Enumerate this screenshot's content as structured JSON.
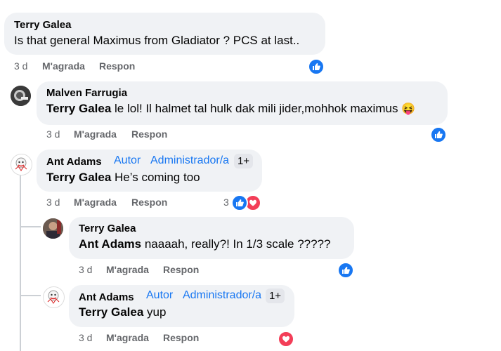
{
  "comments": [
    {
      "author": "Terry Galea",
      "text": "Is that general Maximus from Gladiator ? PCS at last..",
      "time": "3 d",
      "like_label": "M'agrada",
      "reply_label": "Respon",
      "reactions": [
        "like"
      ]
    },
    {
      "author": "Malven Farrugia",
      "mention": "Terry Galea",
      "text": " le lol! Il halmet tal hulk dak mili jider,mohhok maximus",
      "emoji": "😝",
      "time": "3 d",
      "like_label": "M'agrada",
      "reply_label": "Respon",
      "reactions": [
        "like"
      ]
    },
    {
      "author": "Ant Adams",
      "badges": [
        "Autor",
        "Administrador/a"
      ],
      "more_badge": "1+",
      "mention": "Terry Galea",
      "text": " He’s coming too",
      "time": "3 d",
      "like_label": "M'agrada",
      "reply_label": "Respon",
      "reaction_count": "3",
      "reactions": [
        "like",
        "love"
      ]
    },
    {
      "author": "Terry Galea",
      "mention": "Ant Adams",
      "text": " naaaah, really?! In 1/3 scale ?????",
      "time": "3 d",
      "like_label": "M'agrada",
      "reply_label": "Respon",
      "reactions": [
        "like"
      ]
    },
    {
      "author": "Ant Adams",
      "badges": [
        "Autor",
        "Administrador/a"
      ],
      "more_badge": "1+",
      "mention": "Terry Galea",
      "text": " yup",
      "time": "3 d",
      "like_label": "M'agrada",
      "reply_label": "Respon",
      "reactions": [
        "love"
      ]
    }
  ],
  "colors": {
    "accent": "#1877f2",
    "love": "#f33e58",
    "bubble": "#f0f2f5",
    "meta": "#65676b"
  },
  "icons": {
    "like": "thumbs-up-icon",
    "love": "heart-icon"
  }
}
